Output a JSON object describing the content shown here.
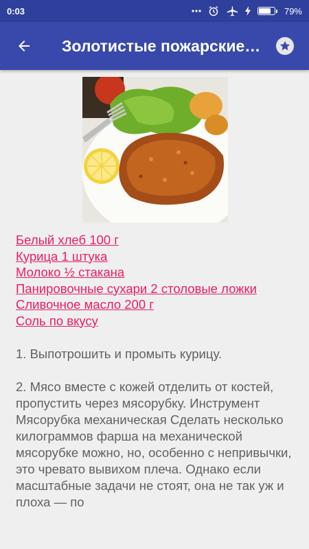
{
  "status_bar": {
    "time": "0:03",
    "battery_percent": "79%",
    "battery_level": 0.79
  },
  "app_bar": {
    "title": "Золотистые пожарские котлеты"
  },
  "ingredients": [
    "Белый хлеб 100 г",
    "Курица 1 штука",
    "Молоко ½ стакана",
    "Панировочные сухари 2 столовые ложки",
    "Сливочное масло 200 г",
    "Соль по вкусу"
  ],
  "steps": [
    "1. Выпотрошить и промыть курицу.",
    "2. Мясо вместе с кожей отделить от костей, пропустить через мясорубку. Инструмент Мясорубка механическая Сделать несколько килограммов фарша на механической мясорубке можно, но, особенно с непривычки, это чревато вывихом плеча. Однако если масштабные задачи не стоят, она не так уж и плоха — по"
  ],
  "colors": {
    "status_bar": "#2f3f9c",
    "app_bar": "#3949ab",
    "link": "#e91e63",
    "body_text": "#616161",
    "background": "#efefef"
  },
  "icons": {
    "back": "arrow-left-icon",
    "favorite": "star-icon",
    "photo": "recipe-photo"
  }
}
